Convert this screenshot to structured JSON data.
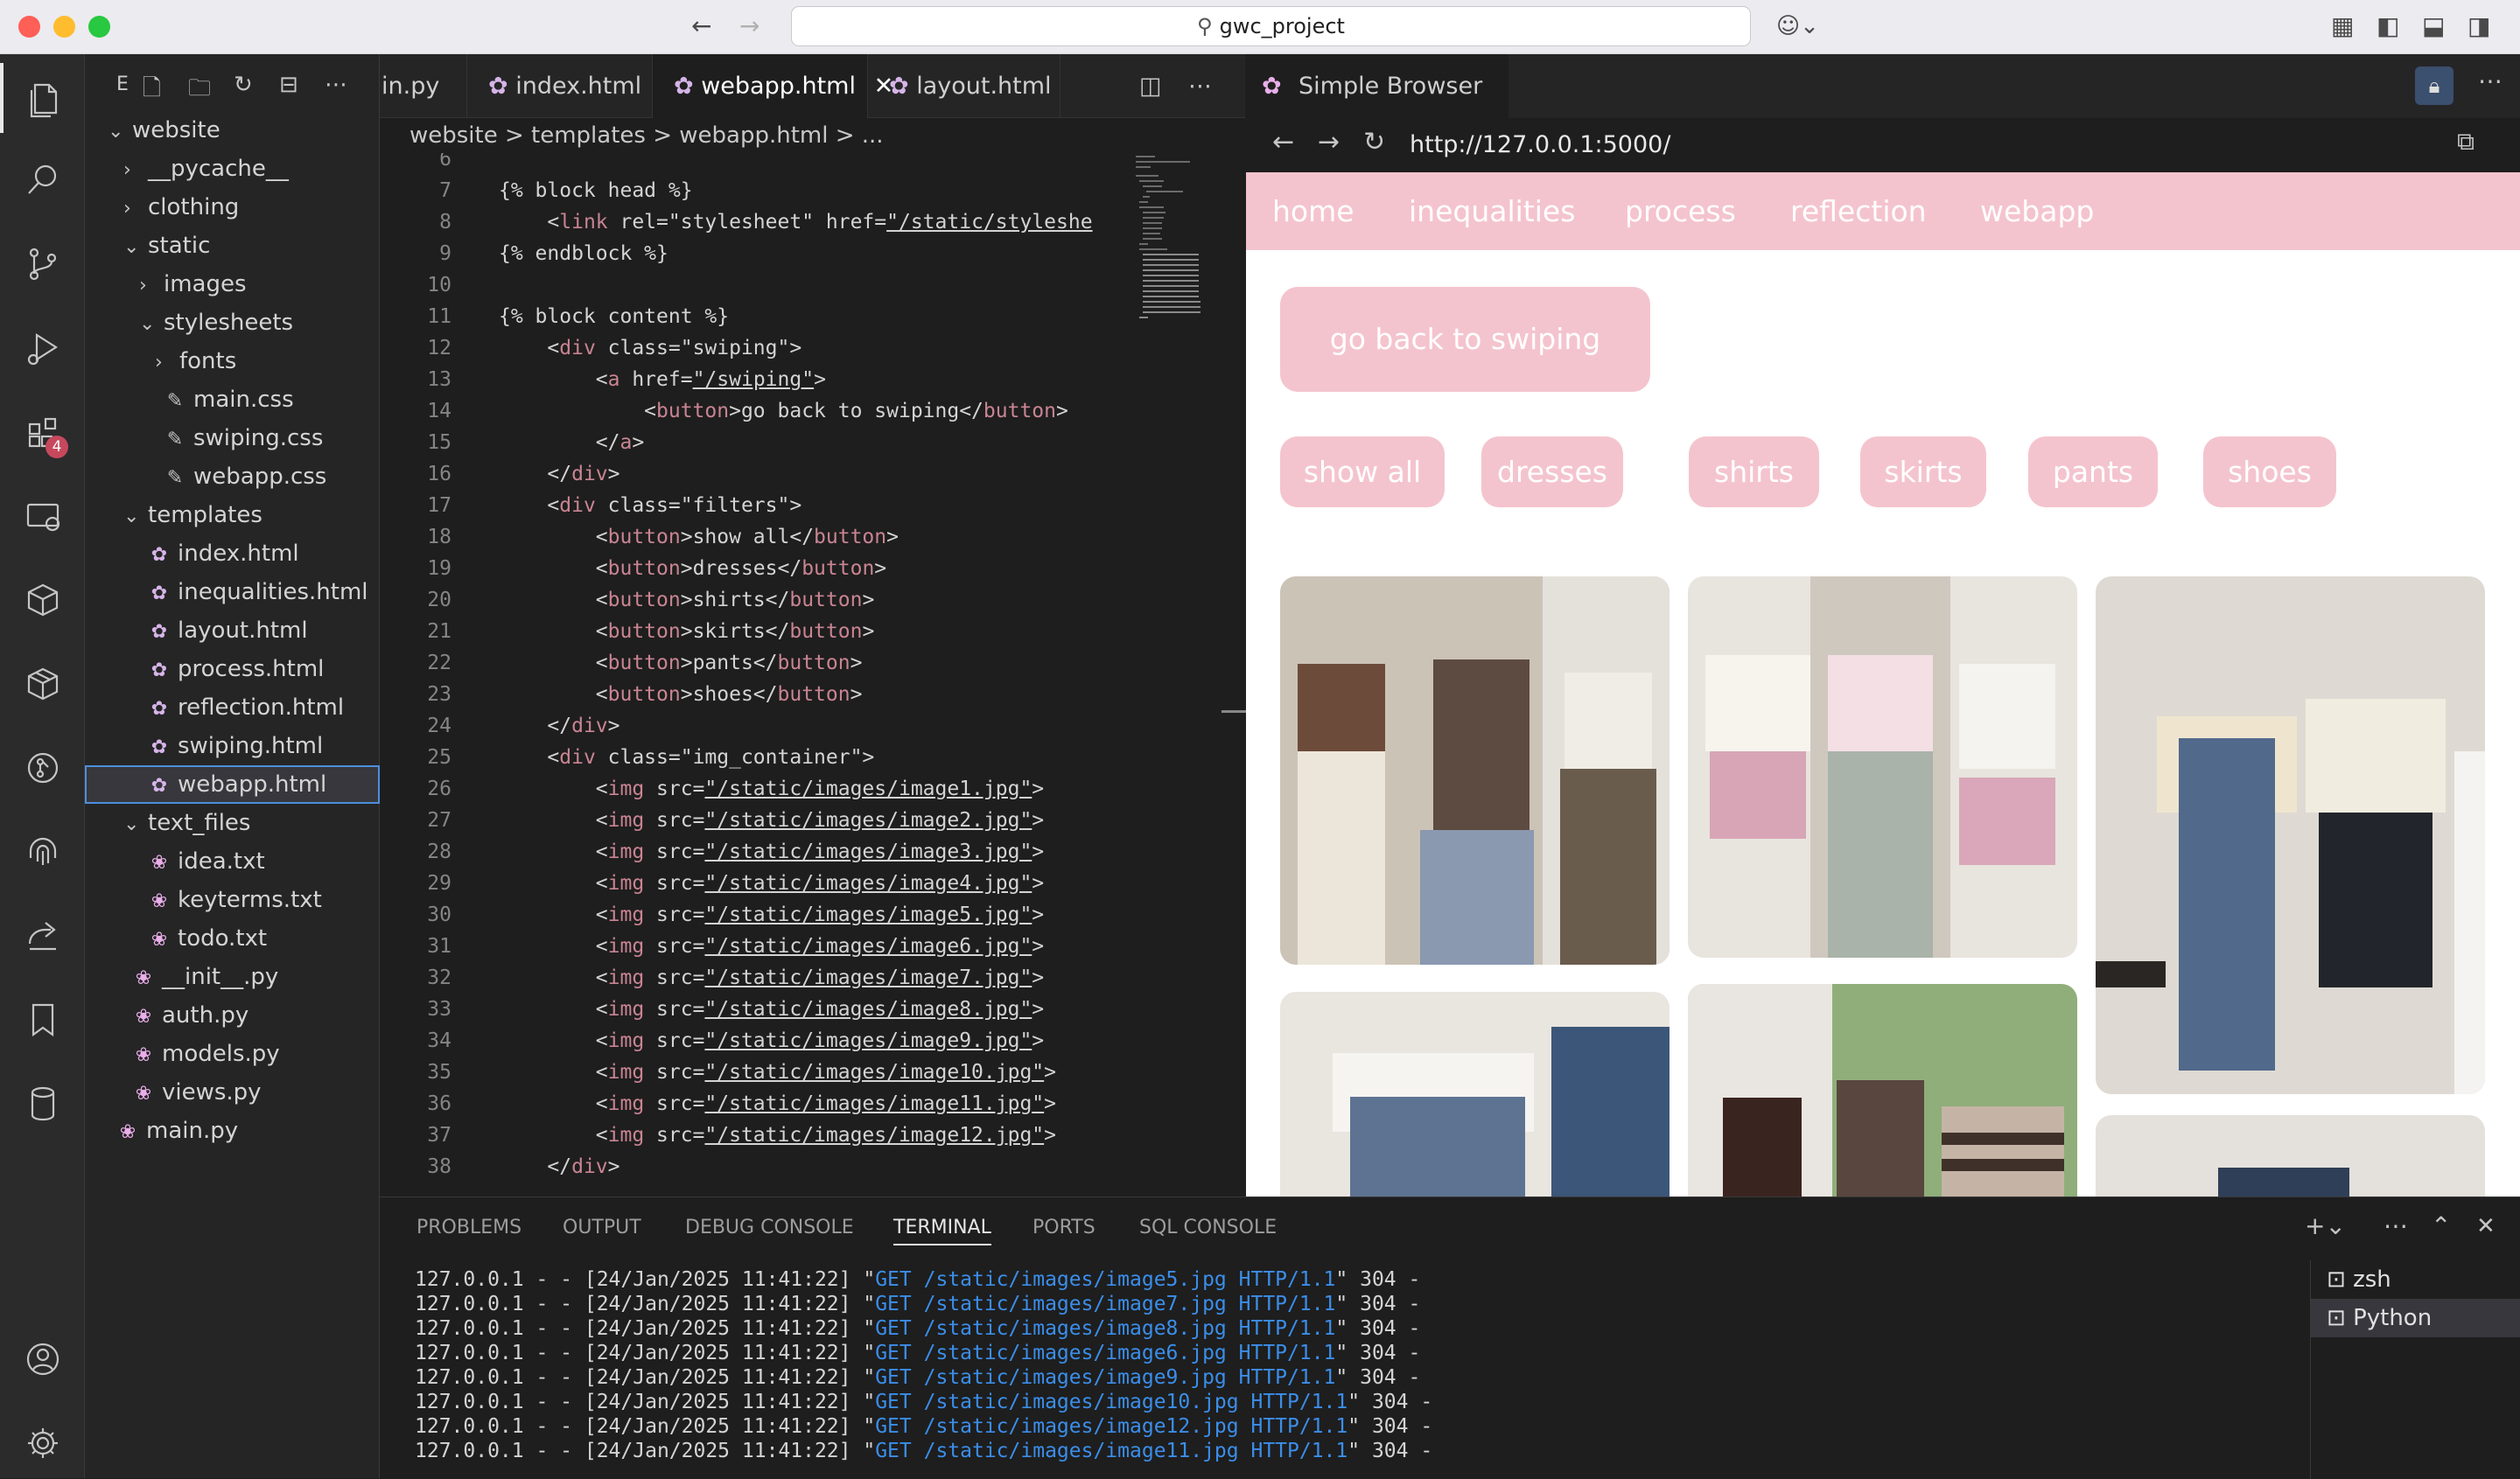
{
  "titlebar": {
    "search": "gwc_project"
  },
  "sidebar": {
    "title": "E",
    "tree": [
      {
        "label": "website",
        "depth": 0,
        "chev": "v",
        "icon": ""
      },
      {
        "label": "__pycache__",
        "depth": 1,
        "chev": ">",
        "icon": ""
      },
      {
        "label": "clothing",
        "depth": 1,
        "chev": ">",
        "icon": ""
      },
      {
        "label": "static",
        "depth": 1,
        "chev": "v",
        "icon": ""
      },
      {
        "label": "images",
        "depth": 2,
        "chev": ">",
        "icon": ""
      },
      {
        "label": "stylesheets",
        "depth": 2,
        "chev": "v",
        "icon": ""
      },
      {
        "label": "fonts",
        "depth": 3,
        "chev": ">",
        "icon": ""
      },
      {
        "label": "main.css",
        "depth": 3,
        "chev": "",
        "icon": "css"
      },
      {
        "label": "swiping.css",
        "depth": 3,
        "chev": "",
        "icon": "css"
      },
      {
        "label": "webapp.css",
        "depth": 3,
        "chev": "",
        "icon": "css"
      },
      {
        "label": "templates",
        "depth": 1,
        "chev": "v",
        "icon": ""
      },
      {
        "label": "index.html",
        "depth": 2,
        "chev": "",
        "icon": "html"
      },
      {
        "label": "inequalities.html",
        "depth": 2,
        "chev": "",
        "icon": "html"
      },
      {
        "label": "layout.html",
        "depth": 2,
        "chev": "",
        "icon": "html"
      },
      {
        "label": "process.html",
        "depth": 2,
        "chev": "",
        "icon": "html"
      },
      {
        "label": "reflection.html",
        "depth": 2,
        "chev": "",
        "icon": "html"
      },
      {
        "label": "swiping.html",
        "depth": 2,
        "chev": "",
        "icon": "html"
      },
      {
        "label": "webapp.html",
        "depth": 2,
        "chev": "",
        "icon": "html",
        "selected": true
      },
      {
        "label": "text_files",
        "depth": 1,
        "chev": "v",
        "icon": ""
      },
      {
        "label": "idea.txt",
        "depth": 2,
        "chev": "",
        "icon": "py"
      },
      {
        "label": "keyterms.txt",
        "depth": 2,
        "chev": "",
        "icon": "py"
      },
      {
        "label": "todo.txt",
        "depth": 2,
        "chev": "",
        "icon": "py"
      },
      {
        "label": "__init__.py",
        "depth": 1,
        "chev": "",
        "icon": "py"
      },
      {
        "label": "auth.py",
        "depth": 1,
        "chev": "",
        "icon": "py"
      },
      {
        "label": "models.py",
        "depth": 1,
        "chev": "",
        "icon": "py"
      },
      {
        "label": "views.py",
        "depth": 1,
        "chev": "",
        "icon": "py"
      },
      {
        "label": "main.py",
        "depth": 0,
        "chev": "",
        "icon": "py"
      }
    ]
  },
  "editor": {
    "tabs": [
      "in.py",
      "index.html",
      "webapp.html",
      "layout.html"
    ],
    "breadcrumb": "website > templates > webapp.html > ...",
    "lines": [
      {
        "n": "6",
        "t": ""
      },
      {
        "n": "7",
        "t": "{% block head %}"
      },
      {
        "n": "8",
        "t": "    <link rel=\"stylesheet\" href=\"/static/styleshe"
      },
      {
        "n": "9",
        "t": "{% endblock %}"
      },
      {
        "n": "10",
        "t": ""
      },
      {
        "n": "11",
        "t": "{% block content %}"
      },
      {
        "n": "12",
        "t": "    <div class=\"swiping\">"
      },
      {
        "n": "13",
        "t": "        <a href=\"/swiping\">"
      },
      {
        "n": "14",
        "t": "            <button>go back to swiping</button>"
      },
      {
        "n": "15",
        "t": "        </a>"
      },
      {
        "n": "16",
        "t": "    </div>"
      },
      {
        "n": "17",
        "t": "    <div class=\"filters\">"
      },
      {
        "n": "18",
        "t": "        <button>show all</button>"
      },
      {
        "n": "19",
        "t": "        <button>dresses</button>"
      },
      {
        "n": "20",
        "t": "        <button>shirts</button>"
      },
      {
        "n": "21",
        "t": "        <button>skirts</button>"
      },
      {
        "n": "22",
        "t": "        <button>pants</button>"
      },
      {
        "n": "23",
        "t": "        <button>shoes</button>"
      },
      {
        "n": "24",
        "t": "    </div>"
      },
      {
        "n": "25",
        "t": "    <div class=\"img_container\">"
      },
      {
        "n": "26",
        "t": "        <img src=\"/static/images/image1.jpg\">"
      },
      {
        "n": "27",
        "t": "        <img src=\"/static/images/image2.jpg\">"
      },
      {
        "n": "28",
        "t": "        <img src=\"/static/images/image3.jpg\">"
      },
      {
        "n": "29",
        "t": "        <img src=\"/static/images/image4.jpg\">"
      },
      {
        "n": "30",
        "t": "        <img src=\"/static/images/image5.jpg\">"
      },
      {
        "n": "31",
        "t": "        <img src=\"/static/images/image6.jpg\">"
      },
      {
        "n": "32",
        "t": "        <img src=\"/static/images/image7.jpg\">"
      },
      {
        "n": "33",
        "t": "        <img src=\"/static/images/image8.jpg\">"
      },
      {
        "n": "34",
        "t": "        <img src=\"/static/images/image9.jpg\">"
      },
      {
        "n": "35",
        "t": "        <img src=\"/static/images/image10.jpg\">"
      },
      {
        "n": "36",
        "t": "        <img src=\"/static/images/image11.jpg\">"
      },
      {
        "n": "37",
        "t": "        <img src=\"/static/images/image12.jpg\">"
      },
      {
        "n": "38",
        "t": "    </div>"
      }
    ]
  },
  "browser": {
    "tab": "Simple Browser",
    "url": "http://127.0.0.1:5000/",
    "menu": [
      "home",
      "inequalities",
      "process",
      "reflection",
      "webapp"
    ],
    "back_button": "go back to swiping",
    "filters": [
      "show all",
      "dresses",
      "shirts",
      "skirts",
      "pants",
      "shoes"
    ],
    "photo_colors": [
      "#b5aea2",
      "#c9c2b6",
      "#d8d3cb",
      "#e2dcd5",
      "#a8a197",
      "#e4e1dc"
    ]
  },
  "panel": {
    "tabs": [
      "PROBLEMS",
      "OUTPUT",
      "DEBUG CONSOLE",
      "TERMINAL",
      "PORTS",
      "SQL CONSOLE"
    ],
    "log": [
      {
        "pre": "127.0.0.1 - - [24/Jan/2025 11:41:22] \"",
        "req": "GET /static/images/image5.jpg HTTP/1.1",
        "post": "\" 304 -"
      },
      {
        "pre": "127.0.0.1 - - [24/Jan/2025 11:41:22] \"",
        "req": "GET /static/images/image7.jpg HTTP/1.1",
        "post": "\" 304 -"
      },
      {
        "pre": "127.0.0.1 - - [24/Jan/2025 11:41:22] \"",
        "req": "GET /static/images/image8.jpg HTTP/1.1",
        "post": "\" 304 -"
      },
      {
        "pre": "127.0.0.1 - - [24/Jan/2025 11:41:22] \"",
        "req": "GET /static/images/image6.jpg HTTP/1.1",
        "post": "\" 304 -"
      },
      {
        "pre": "127.0.0.1 - - [24/Jan/2025 11:41:22] \"",
        "req": "GET /static/images/image9.jpg HTTP/1.1",
        "post": "\" 304 -"
      },
      {
        "pre": "127.0.0.1 - - [24/Jan/2025 11:41:22] \"",
        "req": "GET /static/images/image10.jpg HTTP/1.1",
        "post": "\" 304 -"
      },
      {
        "pre": "127.0.0.1 - - [24/Jan/2025 11:41:22] \"",
        "req": "GET /static/images/image12.jpg HTTP/1.1",
        "post": "\" 304 -"
      },
      {
        "pre": "127.0.0.1 - - [24/Jan/2025 11:41:22] \"",
        "req": "GET /static/images/image11.jpg HTTP/1.1",
        "post": "\" 304 -"
      }
    ],
    "terminals": [
      "zsh",
      "Python"
    ]
  }
}
